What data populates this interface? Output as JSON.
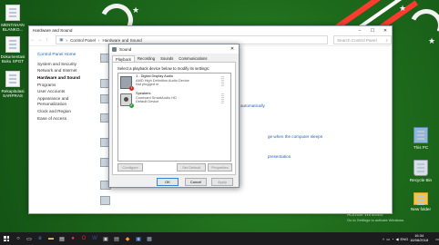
{
  "desktop": {
    "icons_left": [
      {
        "label": "MENTAHAN BLANKO..."
      },
      {
        "label": "Dokumentasi Buku SPGT"
      },
      {
        "label": "Rekapitulasi SARPRAS"
      }
    ],
    "icons_right": [
      {
        "label": "This PC",
        "icon": "computer-icon"
      },
      {
        "label": "Recycle Bin",
        "icon": "recycle-bin-icon"
      },
      {
        "label": "New folder",
        "icon": "folder-icon"
      }
    ],
    "watermark": [
      "Activate Windows",
      "Go to Settings to activate Windows."
    ]
  },
  "explorer": {
    "title": "Hardware and Sound",
    "breadcrumb": [
      "Control Panel",
      "Hardware and Sound"
    ],
    "search_placeholder": "Search Control Panel",
    "sidebar": [
      "Control Panel Home",
      "System and Security",
      "Network and Internet",
      "Hardware and Sound",
      "Programs",
      "User Accounts",
      "Appearance and Personalization",
      "Clock and Region",
      "Ease of Access"
    ],
    "selected": "Hardware and Sound",
    "right_links": [
      "automatically",
      "ge when the computer sleeps",
      "presentation"
    ]
  },
  "sound_dialog": {
    "title": "Sound",
    "tabs": [
      "Playback",
      "Recording",
      "Sounds",
      "Communications"
    ],
    "active_tab": "Playback",
    "instruction": "Select a playback device below to modify its settings:",
    "devices": [
      {
        "name": "1 - Digital Display Audio",
        "line2": "AMD High Definition Audio Device",
        "status": "Not plugged in",
        "badge": "!"
      },
      {
        "name": "Speakers",
        "line2": "Conexant SmartAudio HD",
        "status": "Default Device",
        "badge": "✓"
      }
    ],
    "buttons": {
      "configure": "Configure",
      "set_default": "Set Default",
      "properties": "Properties",
      "ok": "OK",
      "cancel": "Cancel",
      "apply": "Apply"
    }
  },
  "taskbar": {
    "time": "16:34",
    "date": "16/08/2018",
    "lang": "ENG"
  }
}
